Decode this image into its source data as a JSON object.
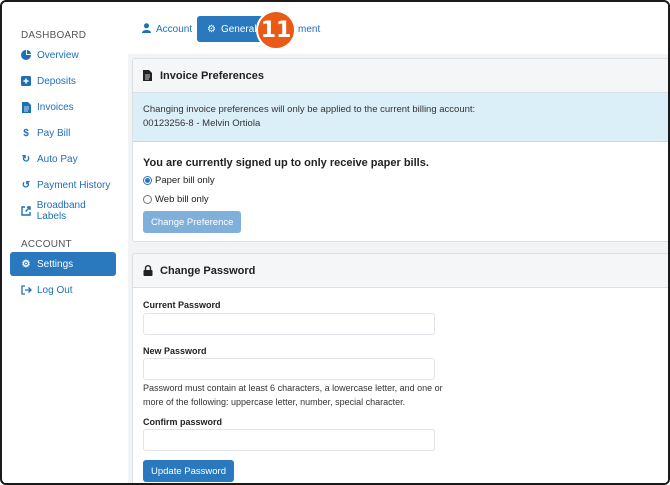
{
  "sidebar": {
    "dashboard_heading": "DASHBOARD",
    "account_heading": "ACCOUNT",
    "items": [
      {
        "label": "Overview",
        "icon": "pie-chart-icon"
      },
      {
        "label": "Deposits",
        "icon": "plus-square-icon"
      },
      {
        "label": "Invoices",
        "icon": "file-icon"
      },
      {
        "label": "Pay Bill",
        "icon": "dollar-icon"
      },
      {
        "label": "Auto Pay",
        "icon": "sync-icon"
      },
      {
        "label": "Payment History",
        "icon": "history-icon"
      },
      {
        "label": "Broadband Labels",
        "icon": "external-link-icon"
      }
    ],
    "account_items": [
      {
        "label": "Settings",
        "icon": "gear-icon"
      },
      {
        "label": "Log Out",
        "icon": "logout-icon"
      }
    ]
  },
  "tabs": {
    "account": "Account",
    "general": "General",
    "third_partial": "ment"
  },
  "step_badge": "11",
  "invoice": {
    "title": "Invoice Preferences",
    "info_line1": "Changing invoice preferences will only be applied to the current billing account:",
    "info_line2": "00123256-8 - Melvin Ortiola",
    "status": "You are currently signed up to only receive paper bills.",
    "option_paper": "Paper bill only",
    "option_web": "Web bill only",
    "selected": "Paper bill only",
    "button": "Change Preference"
  },
  "password": {
    "title": "Change Password",
    "current_label": "Current Password",
    "new_label": "New Password",
    "help": "Password must contain at least 6 characters, a lowercase letter, and one or more of the following: uppercase letter, number, special character.",
    "confirm_label": "Confirm password",
    "button": "Update Password"
  },
  "colors": {
    "accent": "#2a78bd",
    "badge": "#ea5a16",
    "info_bg": "#dbeff9"
  }
}
